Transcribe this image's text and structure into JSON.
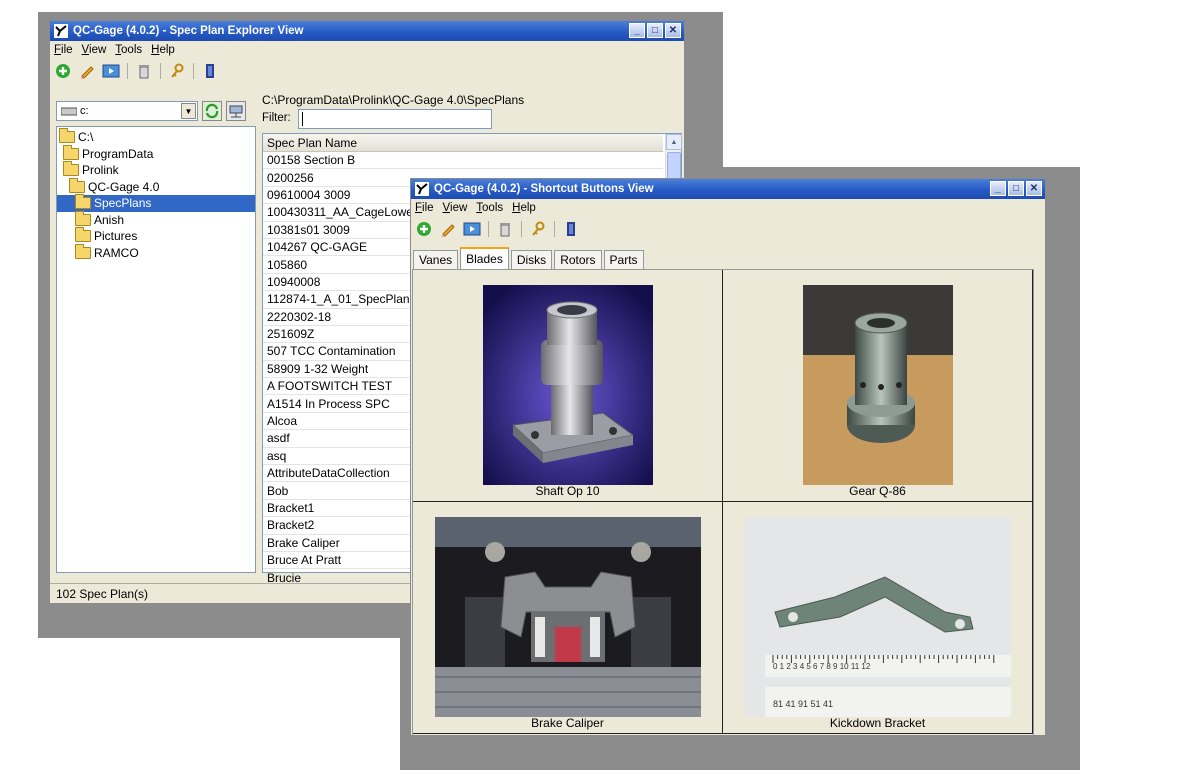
{
  "explorer": {
    "title": "QC-Gage (4.0.2) - Spec Plan Explorer View",
    "menu": [
      "File",
      "View",
      "Tools",
      "Help"
    ],
    "drive": "c:",
    "tree": [
      {
        "label": "C:\\",
        "depth": 0
      },
      {
        "label": "ProgramData",
        "depth": 1
      },
      {
        "label": "Prolink",
        "depth": 1
      },
      {
        "label": "QC-Gage 4.0",
        "depth": 2
      },
      {
        "label": "SpecPlans",
        "depth": 3,
        "selected": true
      },
      {
        "label": "Anish",
        "depth": 3
      },
      {
        "label": "Pictures",
        "depth": 3
      },
      {
        "label": "RAMCO",
        "depth": 3
      }
    ],
    "path": "C:\\ProgramData\\Prolink\\QC-Gage 4.0\\SpecPlans",
    "filter_label": "Filter:",
    "filter_value": "",
    "column_header": "Spec Plan Name",
    "spec_plans": [
      "00158 Section B",
      "0200256",
      "09610004 3009",
      "100430311_AA_CageLowe",
      "10381s01 3009",
      "104267 QC-GAGE",
      "105860",
      "10940008",
      "112874-1_A_01_SpecPlan",
      "2220302-18",
      "251609Z",
      "507 TCC Contamination",
      "58909 1-32 Weight",
      "A FOOTSWITCH TEST",
      "A1514 In Process SPC",
      "Alcoa",
      "asdf",
      "asq",
      "AttributeDataCollection",
      "Bob",
      "Bracket1",
      "Bracket2",
      "Brake Caliper",
      "Bruce At Pratt",
      "Brucie"
    ],
    "status": "102 Spec Plan(s)"
  },
  "shortcut": {
    "title": "QC-Gage (4.0.2) - Shortcut Buttons View",
    "menu": [
      "File",
      "View",
      "Tools",
      "Help"
    ],
    "tabs": [
      "Vanes",
      "Blades",
      "Disks",
      "Rotors",
      "Parts"
    ],
    "active_tab": "Blades",
    "buttons": [
      {
        "caption": "Shaft Op 10"
      },
      {
        "caption": "Gear Q-86"
      },
      {
        "caption": "Brake Caliper"
      },
      {
        "caption": "Kickdown Bracket"
      }
    ]
  },
  "colors": {
    "titlebar": "#2458c4",
    "selection": "#3168c6",
    "window_bg": "#ece9d8"
  }
}
